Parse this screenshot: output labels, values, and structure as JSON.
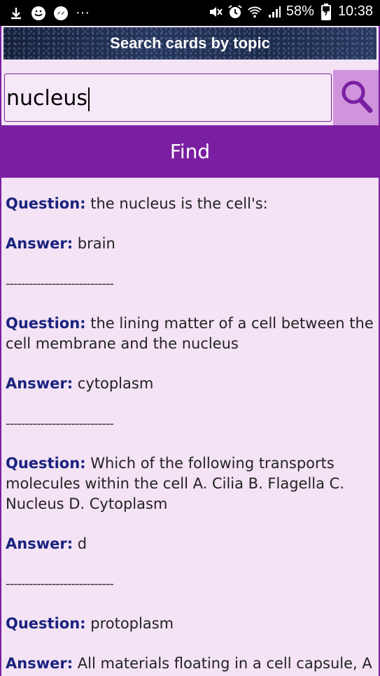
{
  "status_bar": {
    "battery": "58%",
    "time": "10:38",
    "more": "···"
  },
  "header": {
    "title": "Search cards by topic"
  },
  "search": {
    "value": "nucleus"
  },
  "find_button": {
    "label": "Find"
  },
  "separator": "----------------------------",
  "results": [
    {
      "q_label": "Question:",
      "question": "the nucleus is the cell's:",
      "a_label": "Answer:",
      "answer": "brain"
    },
    {
      "q_label": "Question:",
      "question": "the lining matter of a cell between the cell membrane and the nucleus",
      "a_label": "Answer:",
      "answer": "cytoplasm"
    },
    {
      "q_label": "Question:",
      "question": "Which of the following transports molecules within the cell A. Cilia B. Flagella C. Nucleus D. Cytoplasm",
      "a_label": "Answer:",
      "answer": "d"
    },
    {
      "q_label": "Question:",
      "question": "protoplasm",
      "a_label": "Answer:",
      "answer": "All materials floating in a cell capsule, A"
    }
  ]
}
